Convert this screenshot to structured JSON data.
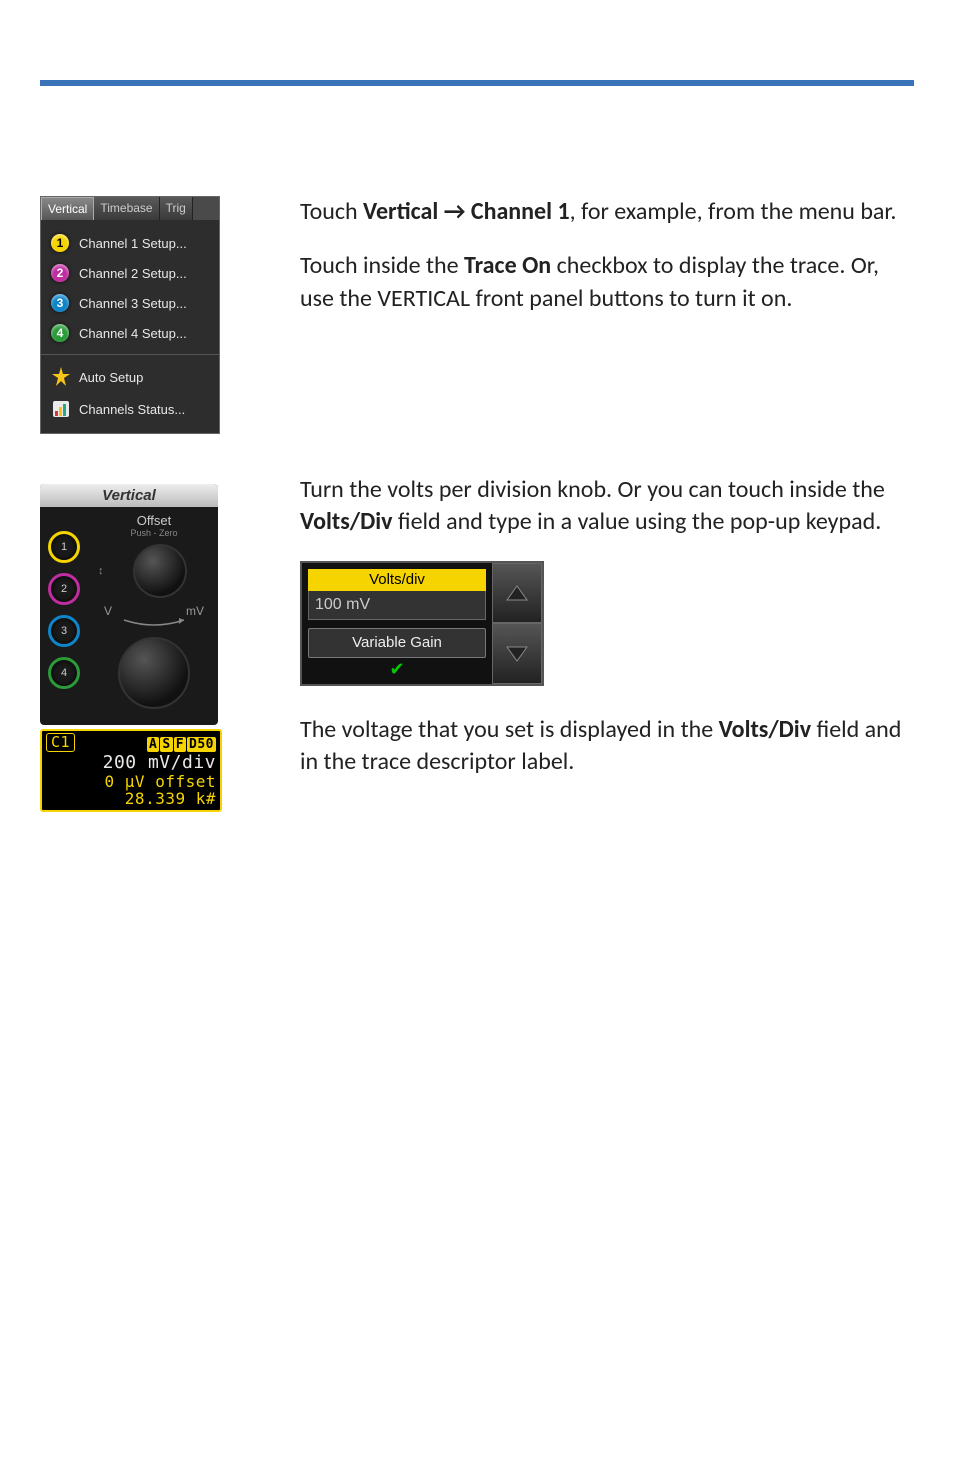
{
  "menu": {
    "tabs": {
      "vertical": "Vertical",
      "timebase": "Timebase",
      "trig": "Trig"
    },
    "items": {
      "ch1": "Channel 1 Setup...",
      "ch2": "Channel 2 Setup...",
      "ch3": "Channel 3 Setup...",
      "ch4": "Channel 4 Setup...",
      "auto": "Auto Setup",
      "status": "Channels Status..."
    },
    "nums": {
      "n1": "1",
      "n2": "2",
      "n3": "3",
      "n4": "4"
    }
  },
  "knob_panel": {
    "title": "Vertical",
    "offset_label": "Offset",
    "offset_sub": "Push - Zero",
    "scale_v": "V",
    "scale_mv": "mV"
  },
  "trace": {
    "channel": "C1",
    "badges": {
      "a": "A",
      "s": "S",
      "f": "F",
      "d": "D50"
    },
    "line2": "200 mV/div",
    "line3": "0 µV offset",
    "line4": "28.339 k#"
  },
  "vdiv": {
    "label": "Volts/div",
    "value": "100 mV",
    "variable_gain": "Variable Gain"
  },
  "copy": {
    "p1a": "Touch ",
    "p1b": "Vertical → Channel 1",
    "p1c": ", for example, from the menu bar.",
    "p2a": "Touch inside the ",
    "p2b": "Trace On",
    "p2c": " checkbox to display the trace. Or, use the VERTICAL front panel buttons to turn it on.",
    "p3a": "Turn the volts per division knob. Or you can touch inside the ",
    "p3b": "Volts/Div",
    "p3c": " field and type in a value using the pop-up keypad.",
    "p4a": "The voltage that you set is displayed in the ",
    "p4b": "Volts/Div",
    "p4c": " field and in the trace descriptor label."
  }
}
